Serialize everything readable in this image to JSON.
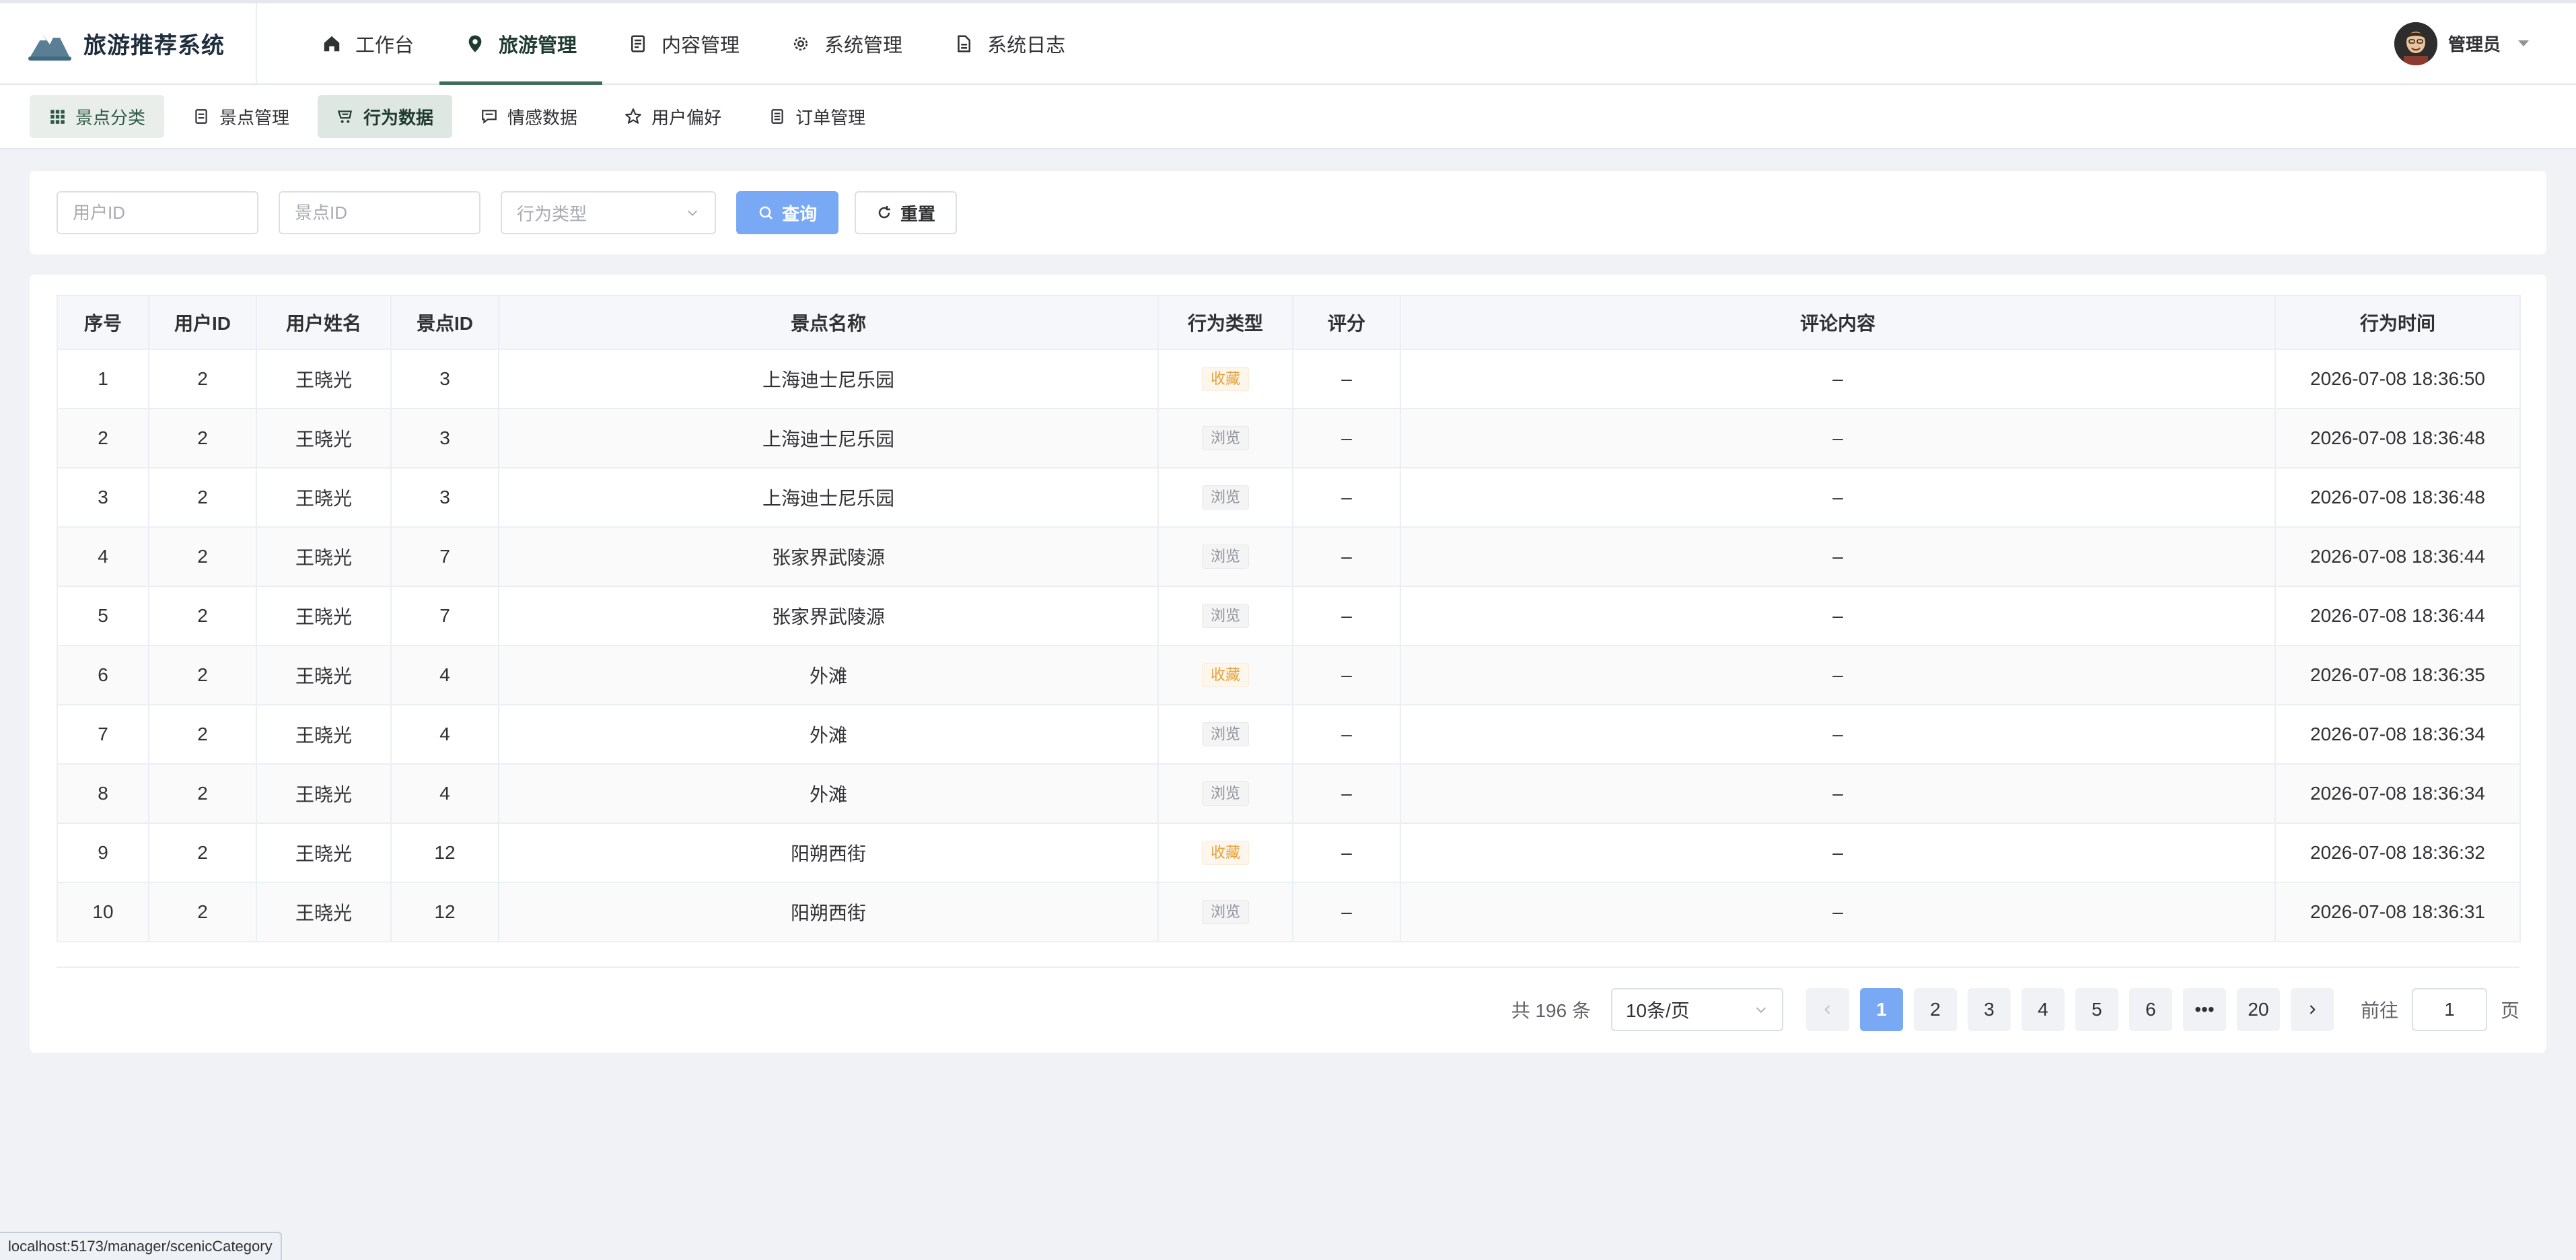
{
  "app": {
    "title": "旅游推荐系统"
  },
  "nav": [
    {
      "label": "工作台",
      "icon": "home-icon"
    },
    {
      "label": "旅游管理",
      "icon": "location-pin-icon",
      "active": true
    },
    {
      "label": "内容管理",
      "icon": "document-icon"
    },
    {
      "label": "系统管理",
      "icon": "gear-icon"
    },
    {
      "label": "系统日志",
      "icon": "log-file-icon"
    }
  ],
  "user": {
    "name": "管理员"
  },
  "subtabs": [
    {
      "label": "景点分类",
      "icon": "grid-icon"
    },
    {
      "label": "景点管理",
      "icon": "document-icon"
    },
    {
      "label": "行为数据",
      "icon": "cart-icon"
    },
    {
      "label": "情感数据",
      "icon": "chat-icon"
    },
    {
      "label": "用户偏好",
      "icon": "star-icon"
    },
    {
      "label": "订单管理",
      "icon": "list-icon"
    }
  ],
  "filters": {
    "user_id_placeholder": "用户ID",
    "scenic_id_placeholder": "景点ID",
    "behavior_type_placeholder": "行为类型",
    "search_label": "查询",
    "reset_label": "重置"
  },
  "table": {
    "columns": [
      "序号",
      "用户ID",
      "用户姓名",
      "景点ID",
      "景点名称",
      "行为类型",
      "评分",
      "评论内容",
      "行为时间"
    ],
    "rows": [
      {
        "index": "1",
        "user_id": "2",
        "user_name": "王晓光",
        "scenic_id": "3",
        "scenic_name": "上海迪士尼乐园",
        "behavior": "收藏",
        "rating": "–",
        "comment": "–",
        "time": "2026-07-08 18:36:50"
      },
      {
        "index": "2",
        "user_id": "2",
        "user_name": "王晓光",
        "scenic_id": "3",
        "scenic_name": "上海迪士尼乐园",
        "behavior": "浏览",
        "rating": "–",
        "comment": "–",
        "time": "2026-07-08 18:36:48"
      },
      {
        "index": "3",
        "user_id": "2",
        "user_name": "王晓光",
        "scenic_id": "3",
        "scenic_name": "上海迪士尼乐园",
        "behavior": "浏览",
        "rating": "–",
        "comment": "–",
        "time": "2026-07-08 18:36:48"
      },
      {
        "index": "4",
        "user_id": "2",
        "user_name": "王晓光",
        "scenic_id": "7",
        "scenic_name": "张家界武陵源",
        "behavior": "浏览",
        "rating": "–",
        "comment": "–",
        "time": "2026-07-08 18:36:44"
      },
      {
        "index": "5",
        "user_id": "2",
        "user_name": "王晓光",
        "scenic_id": "7",
        "scenic_name": "张家界武陵源",
        "behavior": "浏览",
        "rating": "–",
        "comment": "–",
        "time": "2026-07-08 18:36:44"
      },
      {
        "index": "6",
        "user_id": "2",
        "user_name": "王晓光",
        "scenic_id": "4",
        "scenic_name": "外滩",
        "behavior": "收藏",
        "rating": "–",
        "comment": "–",
        "time": "2026-07-08 18:36:35"
      },
      {
        "index": "7",
        "user_id": "2",
        "user_name": "王晓光",
        "scenic_id": "4",
        "scenic_name": "外滩",
        "behavior": "浏览",
        "rating": "–",
        "comment": "–",
        "time": "2026-07-08 18:36:34"
      },
      {
        "index": "8",
        "user_id": "2",
        "user_name": "王晓光",
        "scenic_id": "4",
        "scenic_name": "外滩",
        "behavior": "浏览",
        "rating": "–",
        "comment": "–",
        "time": "2026-07-08 18:36:34"
      },
      {
        "index": "9",
        "user_id": "2",
        "user_name": "王晓光",
        "scenic_id": "12",
        "scenic_name": "阳朔西街",
        "behavior": "收藏",
        "rating": "–",
        "comment": "–",
        "time": "2026-07-08 18:36:32"
      },
      {
        "index": "10",
        "user_id": "2",
        "user_name": "王晓光",
        "scenic_id": "12",
        "scenic_name": "阳朔西街",
        "behavior": "浏览",
        "rating": "–",
        "comment": "–",
        "time": "2026-07-08 18:36:31"
      }
    ]
  },
  "pagination": {
    "total_text": "共 196 条",
    "page_size": "10条/页",
    "pages": [
      "1",
      "2",
      "3",
      "4",
      "5",
      "6",
      "•••",
      "20"
    ],
    "current_page": "1",
    "goto_label": "前往",
    "goto_value": "1",
    "page_suffix": "页"
  },
  "statusbar": {
    "url": "localhost:5173/manager/scenicCategory"
  },
  "colors": {
    "primary": "#79a9f5",
    "accent": "#3c6e5a",
    "tag_favorite": "#e6a23c",
    "tag_view": "#909399"
  }
}
